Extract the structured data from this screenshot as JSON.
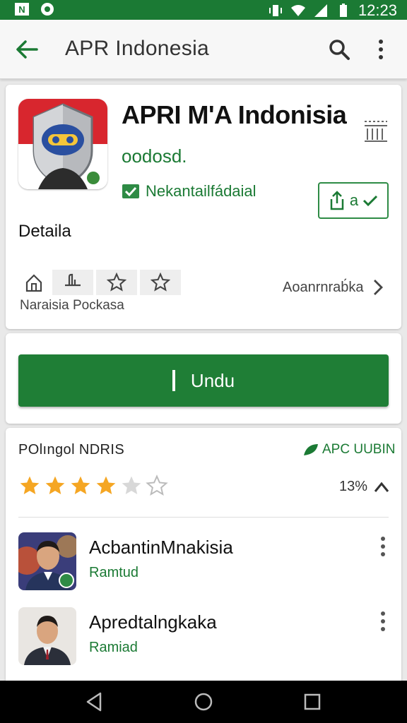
{
  "status_bar": {
    "time": "12:23",
    "left_icons": [
      "notification-icon",
      "settings-icon"
    ],
    "right_icons": [
      "vibrate-icon",
      "wifi-icon",
      "signal-icon",
      "battery-icon"
    ]
  },
  "app_bar": {
    "title": "APR Indonesia",
    "icons": [
      "back-arrow-icon",
      "search-icon",
      "more-vert-icon"
    ]
  },
  "app_header": {
    "title": "APRI M'A Indonisia",
    "subtitle": "oodosd.",
    "verified_text": "Nekantailfádaial",
    "install_small_label": "a",
    "details_label": "Detaila",
    "actions_caption": "Naraisia Pockasa",
    "more_link": "Aoanrnrab́ka",
    "corner_icon": "library-icon"
  },
  "install": {
    "label": "Undu"
  },
  "reviews": {
    "header": "POlıngol NDRIS",
    "link": "APC UUBIN",
    "rating_filled": 4,
    "rating_total": 6,
    "percent": "13%",
    "colors": {
      "star_filled": "#f5a623",
      "star_empty": "#d8d8d8",
      "accent": "#1b7a34"
    },
    "items": [
      {
        "name": "AcbantinMnakisia",
        "sub": "Ramtud"
      },
      {
        "name": "Apredtalngkaka",
        "sub": "Ramiad"
      }
    ]
  },
  "nav_bar": {
    "icons": [
      "back-triangle-icon",
      "home-circle-icon",
      "recents-square-icon"
    ]
  }
}
